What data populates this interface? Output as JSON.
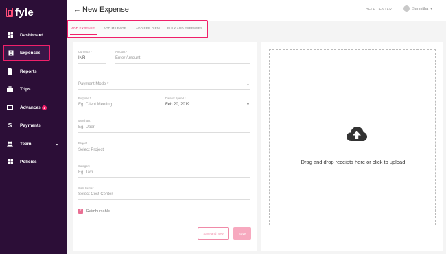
{
  "app": {
    "logo_text": "fyle"
  },
  "sidebar": {
    "items": [
      {
        "label": "Dashboard",
        "icon": "dashboard-icon"
      },
      {
        "label": "Expenses",
        "icon": "receipt-icon",
        "active": true
      },
      {
        "label": "Reports",
        "icon": "document-icon"
      },
      {
        "label": "Trips",
        "icon": "briefcase-icon"
      },
      {
        "label": "Advances",
        "icon": "wallet-icon",
        "badge": "1"
      },
      {
        "label": "Payments",
        "icon": "dollar-icon"
      },
      {
        "label": "Team",
        "icon": "people-icon",
        "has_chevron": true
      },
      {
        "label": "Policies",
        "icon": "grid-icon"
      }
    ]
  },
  "header": {
    "back": "←",
    "title": "New Expense",
    "help_center": "HELP CENTER",
    "username": "Sunmitha"
  },
  "tabs": [
    {
      "label": "ADD EXPENSE",
      "active": true
    },
    {
      "label": "ADD MILEAGE"
    },
    {
      "label": "ADD PER DIEM"
    },
    {
      "label": "BULK ADD EXPENSES"
    }
  ],
  "form": {
    "currency_label": "Currency *",
    "currency_value": "INR",
    "amount_label": "Amount *",
    "amount_placeholder": "Enter Amount",
    "payment_mode_placeholder": "Payment Mode *",
    "purpose_label": "Purpose *",
    "purpose_placeholder": "Eg. Client Meeting",
    "date_label": "Date of Spend *",
    "date_value": "Feb 20, 2019",
    "merchant_label": "Merchant",
    "merchant_placeholder": "Eg. Uber",
    "project_label": "Project",
    "project_placeholder": "Select Project",
    "category_label": "Category",
    "category_placeholder": "Eg. Taxi",
    "cost_center_label": "Cost Center",
    "cost_center_placeholder": "Select Cost Center",
    "reimbursable_label": "Reimbursable",
    "reimbursable_checked": true,
    "save_new_label": "Save and New",
    "save_label": "Save"
  },
  "upload": {
    "text": "Drag and drop receipts here or click to upload",
    "icon": "cloud-upload-icon"
  },
  "colors": {
    "sidebar_bg": "#2c0e37",
    "accent": "#f0206a",
    "accent_light": "#f7a9bf"
  }
}
